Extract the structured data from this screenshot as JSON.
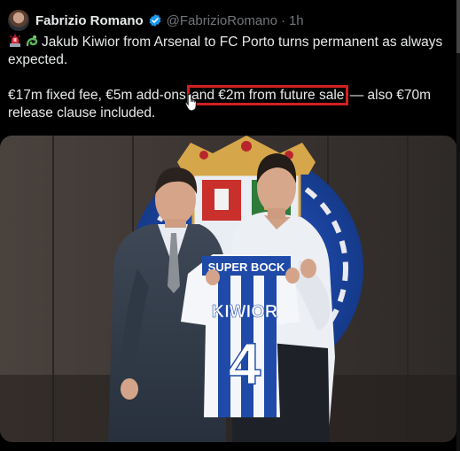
{
  "tweet": {
    "author_name": "Fabrizio Romano",
    "handle": "@FabrizioRomano",
    "separator": "·",
    "time": "1h",
    "line1_text": "Jakub Kiwior from Arsenal to FC Porto turns permanent as always expected.",
    "para2_part1": "€17m fixed fee, €5m add-ons",
    "para2_highlight": "and €2m from future sale",
    "para2_part2": " — also €70m release clause included.",
    "emojis": [
      "police-light-emoji",
      "dragon-emoji"
    ]
  },
  "media": {
    "shirt_sponsor": "SUPER BOCK",
    "shirt_name": "KIWIOR",
    "shirt_number": "4"
  },
  "colors": {
    "background": "#000000",
    "text": "#e7e9ea",
    "muted": "#71767b",
    "verified_blue": "#1d9bf0",
    "highlight_box": "#d12020",
    "porto_blue": "#1f4aa8"
  }
}
